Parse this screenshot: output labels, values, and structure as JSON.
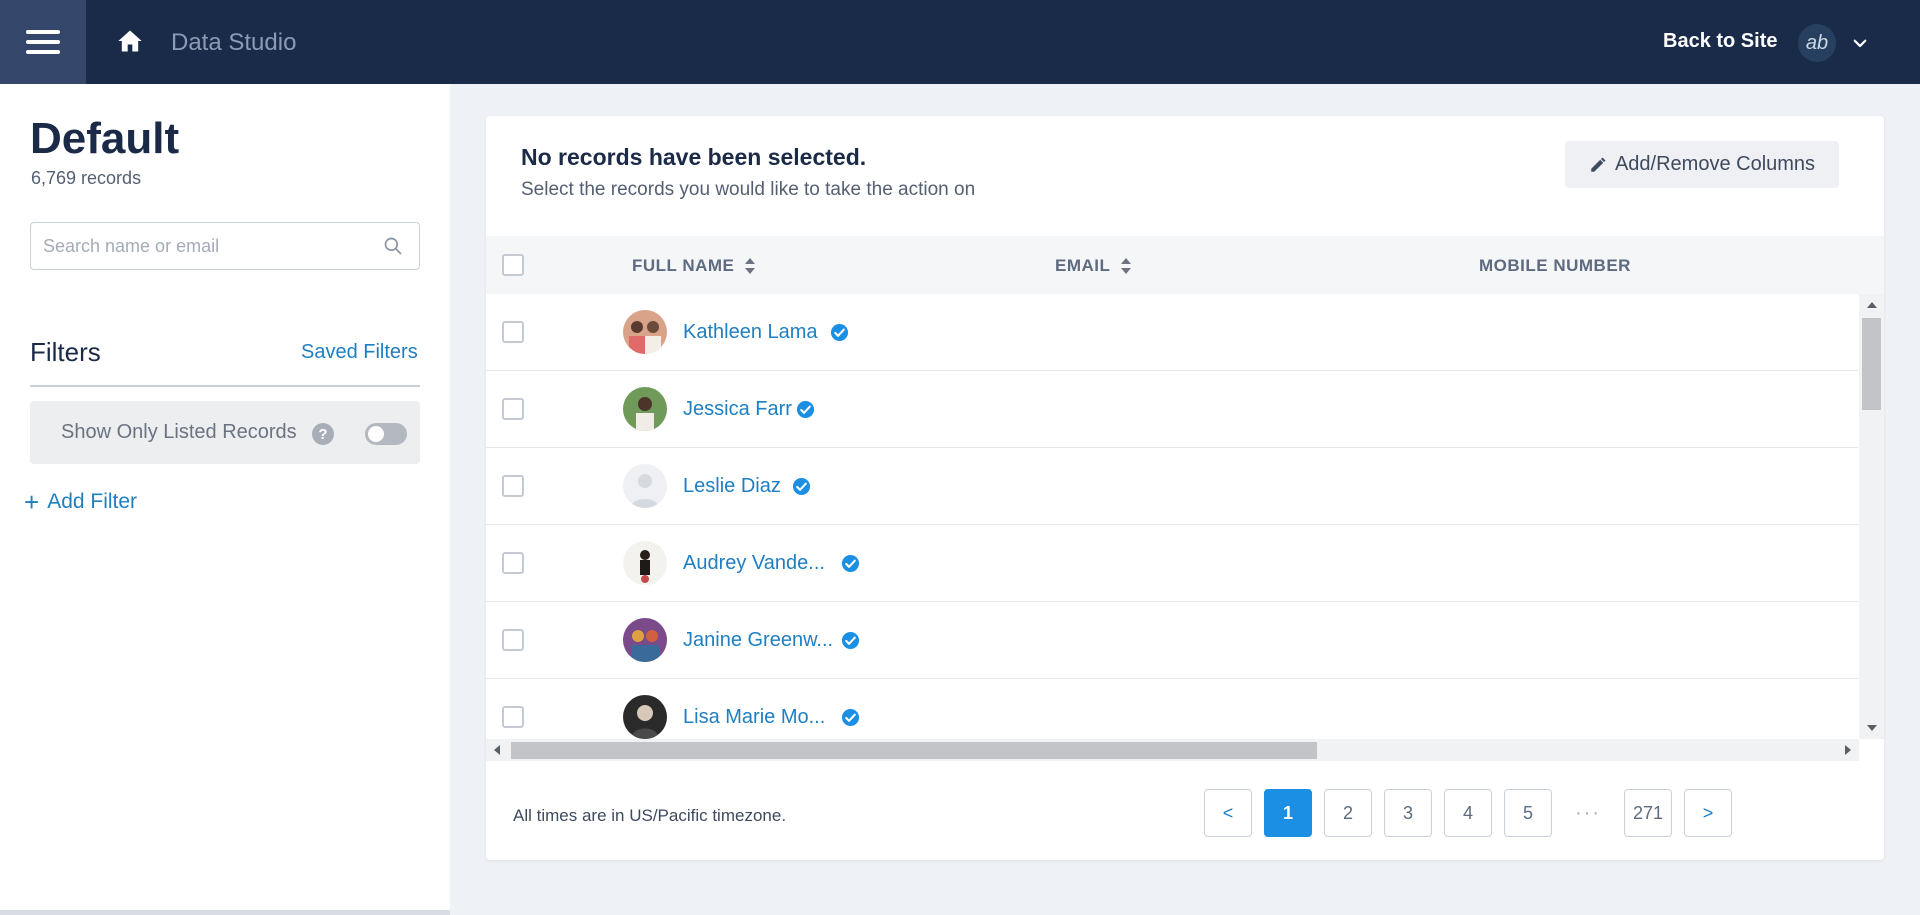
{
  "header": {
    "app_title": "Data Studio",
    "back_label": "Back to Site",
    "avatar_text": "ab"
  },
  "sidebar": {
    "title": "Default",
    "record_count": "6,769 records",
    "search_placeholder": "Search name or email",
    "filters_title": "Filters",
    "saved_filters_label": "Saved Filters",
    "toggle_label": "Show Only Listed Records",
    "toggle_on": false,
    "add_filter_label": "Add Filter"
  },
  "main": {
    "selection_title": "No records have been selected.",
    "selection_subtitle": "Select the records you would like to take the action on",
    "columns_button_label": "Add/Remove Columns",
    "columns": [
      {
        "label": "FULL NAME",
        "sortable": true
      },
      {
        "label": "EMAIL",
        "sortable": true
      },
      {
        "label": "MOBILE NUMBER",
        "sortable": false
      }
    ],
    "rows": [
      {
        "name": "Kathleen Lama",
        "verified": true
      },
      {
        "name": "Jessica Farr",
        "verified": true
      },
      {
        "name": "Leslie Diaz",
        "verified": true
      },
      {
        "name": "Audrey Vande...",
        "verified": true
      },
      {
        "name": "Janine Greenw...",
        "verified": true
      },
      {
        "name": "Lisa Marie Mo...",
        "verified": true
      }
    ],
    "timezone_note": "All times are in US/Pacific timezone.",
    "pagination": {
      "prev": "<",
      "pages": [
        "1",
        "2",
        "3",
        "4",
        "5"
      ],
      "dots": "···",
      "last": "271",
      "next": ">",
      "current": "1"
    }
  },
  "colors": {
    "topbar": "#1a2b4a",
    "accent": "#1e7fc1",
    "active_page": "#1a8fe3"
  }
}
